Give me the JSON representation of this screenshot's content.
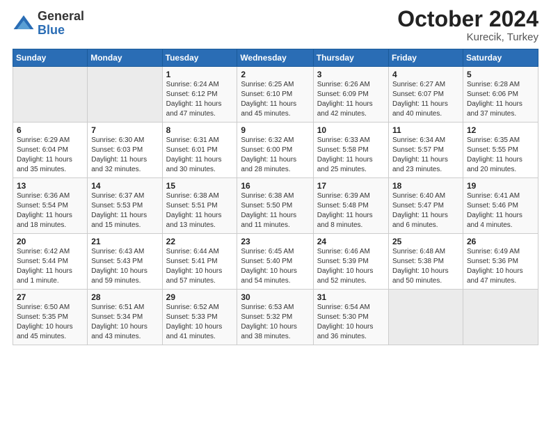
{
  "header": {
    "logo": {
      "general": "General",
      "blue": "Blue"
    },
    "title": "October 2024",
    "location": "Kurecik, Turkey"
  },
  "weekdays": [
    "Sunday",
    "Monday",
    "Tuesday",
    "Wednesday",
    "Thursday",
    "Friday",
    "Saturday"
  ],
  "weeks": [
    [
      {
        "day": "",
        "info": ""
      },
      {
        "day": "",
        "info": ""
      },
      {
        "day": "1",
        "info": "Sunrise: 6:24 AM\nSunset: 6:12 PM\nDaylight: 11 hours and 47 minutes."
      },
      {
        "day": "2",
        "info": "Sunrise: 6:25 AM\nSunset: 6:10 PM\nDaylight: 11 hours and 45 minutes."
      },
      {
        "day": "3",
        "info": "Sunrise: 6:26 AM\nSunset: 6:09 PM\nDaylight: 11 hours and 42 minutes."
      },
      {
        "day": "4",
        "info": "Sunrise: 6:27 AM\nSunset: 6:07 PM\nDaylight: 11 hours and 40 minutes."
      },
      {
        "day": "5",
        "info": "Sunrise: 6:28 AM\nSunset: 6:06 PM\nDaylight: 11 hours and 37 minutes."
      }
    ],
    [
      {
        "day": "6",
        "info": "Sunrise: 6:29 AM\nSunset: 6:04 PM\nDaylight: 11 hours and 35 minutes."
      },
      {
        "day": "7",
        "info": "Sunrise: 6:30 AM\nSunset: 6:03 PM\nDaylight: 11 hours and 32 minutes."
      },
      {
        "day": "8",
        "info": "Sunrise: 6:31 AM\nSunset: 6:01 PM\nDaylight: 11 hours and 30 minutes."
      },
      {
        "day": "9",
        "info": "Sunrise: 6:32 AM\nSunset: 6:00 PM\nDaylight: 11 hours and 28 minutes."
      },
      {
        "day": "10",
        "info": "Sunrise: 6:33 AM\nSunset: 5:58 PM\nDaylight: 11 hours and 25 minutes."
      },
      {
        "day": "11",
        "info": "Sunrise: 6:34 AM\nSunset: 5:57 PM\nDaylight: 11 hours and 23 minutes."
      },
      {
        "day": "12",
        "info": "Sunrise: 6:35 AM\nSunset: 5:55 PM\nDaylight: 11 hours and 20 minutes."
      }
    ],
    [
      {
        "day": "13",
        "info": "Sunrise: 6:36 AM\nSunset: 5:54 PM\nDaylight: 11 hours and 18 minutes."
      },
      {
        "day": "14",
        "info": "Sunrise: 6:37 AM\nSunset: 5:53 PM\nDaylight: 11 hours and 15 minutes."
      },
      {
        "day": "15",
        "info": "Sunrise: 6:38 AM\nSunset: 5:51 PM\nDaylight: 11 hours and 13 minutes."
      },
      {
        "day": "16",
        "info": "Sunrise: 6:38 AM\nSunset: 5:50 PM\nDaylight: 11 hours and 11 minutes."
      },
      {
        "day": "17",
        "info": "Sunrise: 6:39 AM\nSunset: 5:48 PM\nDaylight: 11 hours and 8 minutes."
      },
      {
        "day": "18",
        "info": "Sunrise: 6:40 AM\nSunset: 5:47 PM\nDaylight: 11 hours and 6 minutes."
      },
      {
        "day": "19",
        "info": "Sunrise: 6:41 AM\nSunset: 5:46 PM\nDaylight: 11 hours and 4 minutes."
      }
    ],
    [
      {
        "day": "20",
        "info": "Sunrise: 6:42 AM\nSunset: 5:44 PM\nDaylight: 11 hours and 1 minute."
      },
      {
        "day": "21",
        "info": "Sunrise: 6:43 AM\nSunset: 5:43 PM\nDaylight: 10 hours and 59 minutes."
      },
      {
        "day": "22",
        "info": "Sunrise: 6:44 AM\nSunset: 5:41 PM\nDaylight: 10 hours and 57 minutes."
      },
      {
        "day": "23",
        "info": "Sunrise: 6:45 AM\nSunset: 5:40 PM\nDaylight: 10 hours and 54 minutes."
      },
      {
        "day": "24",
        "info": "Sunrise: 6:46 AM\nSunset: 5:39 PM\nDaylight: 10 hours and 52 minutes."
      },
      {
        "day": "25",
        "info": "Sunrise: 6:48 AM\nSunset: 5:38 PM\nDaylight: 10 hours and 50 minutes."
      },
      {
        "day": "26",
        "info": "Sunrise: 6:49 AM\nSunset: 5:36 PM\nDaylight: 10 hours and 47 minutes."
      }
    ],
    [
      {
        "day": "27",
        "info": "Sunrise: 6:50 AM\nSunset: 5:35 PM\nDaylight: 10 hours and 45 minutes."
      },
      {
        "day": "28",
        "info": "Sunrise: 6:51 AM\nSunset: 5:34 PM\nDaylight: 10 hours and 43 minutes."
      },
      {
        "day": "29",
        "info": "Sunrise: 6:52 AM\nSunset: 5:33 PM\nDaylight: 10 hours and 41 minutes."
      },
      {
        "day": "30",
        "info": "Sunrise: 6:53 AM\nSunset: 5:32 PM\nDaylight: 10 hours and 38 minutes."
      },
      {
        "day": "31",
        "info": "Sunrise: 6:54 AM\nSunset: 5:30 PM\nDaylight: 10 hours and 36 minutes."
      },
      {
        "day": "",
        "info": ""
      },
      {
        "day": "",
        "info": ""
      }
    ]
  ]
}
